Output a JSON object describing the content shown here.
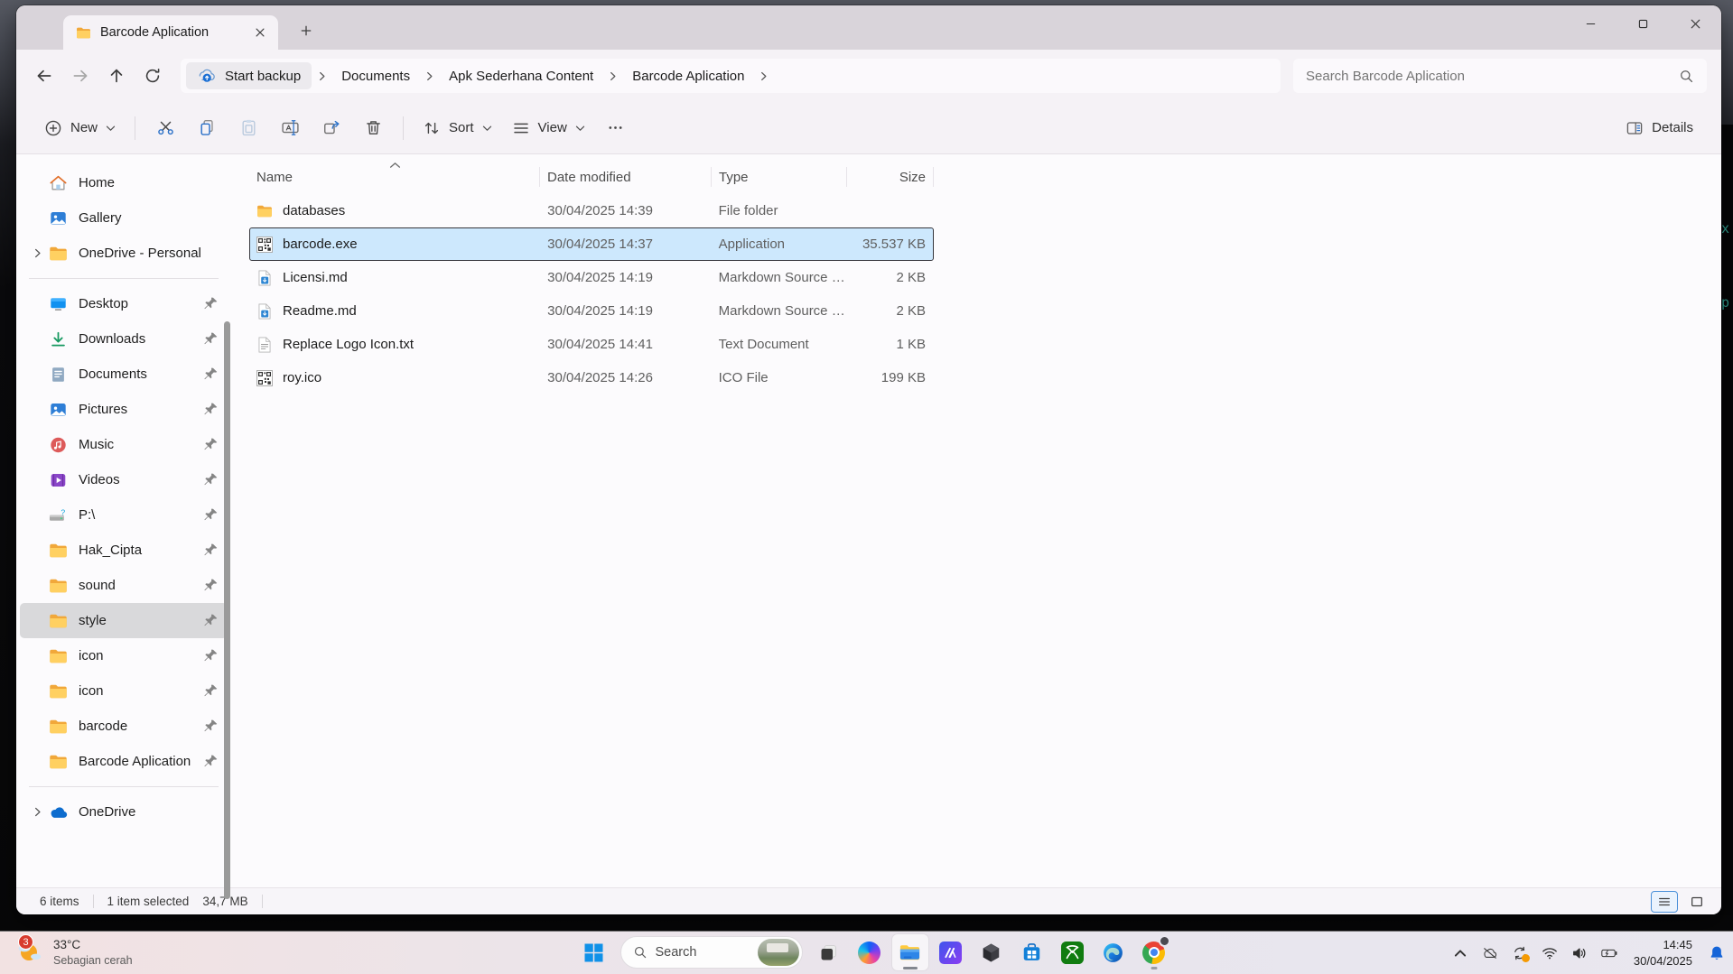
{
  "background": {
    "edge_marks": [
      "x",
      "p"
    ]
  },
  "window": {
    "tab": {
      "title": "Barcode Aplication"
    },
    "breadcrumb": {
      "backup_label": "Start backup",
      "items": [
        "Documents",
        "Apk Sederhana Content",
        "Barcode Aplication"
      ]
    },
    "search": {
      "placeholder": "Search Barcode Aplication"
    },
    "toolbar": {
      "new_label": "New",
      "sort_label": "Sort",
      "view_label": "View",
      "details_label": "Details"
    },
    "columns": {
      "name": "Name",
      "date_modified": "Date modified",
      "type": "Type",
      "size": "Size"
    },
    "files": [
      {
        "name": "databases",
        "date": "30/04/2025 14:39",
        "type": "File folder",
        "size": "",
        "icon": "folder-icon",
        "selected": false
      },
      {
        "name": "barcode.exe",
        "date": "30/04/2025 14:37",
        "type": "Application",
        "size": "35.537 KB",
        "icon": "barcode-app-icon",
        "selected": true
      },
      {
        "name": "Licensi.md",
        "date": "30/04/2025 14:19",
        "type": "Markdown Source …",
        "size": "2 KB",
        "icon": "markdown-file-icon",
        "selected": false
      },
      {
        "name": "Readme.md",
        "date": "30/04/2025 14:19",
        "type": "Markdown Source …",
        "size": "2 KB",
        "icon": "markdown-file-icon",
        "selected": false
      },
      {
        "name": "Replace Logo Icon.txt",
        "date": "30/04/2025 14:41",
        "type": "Text Document",
        "size": "1 KB",
        "icon": "text-file-icon",
        "selected": false
      },
      {
        "name": "roy.ico",
        "date": "30/04/2025 14:26",
        "type": "ICO File",
        "size": "199 KB",
        "icon": "ico-file-icon",
        "selected": false
      }
    ],
    "sidebar": {
      "sections": [
        {
          "items": [
            {
              "label": "Home",
              "icon": "home-icon",
              "pinned": false,
              "expander": false,
              "selected": false
            },
            {
              "label": "Gallery",
              "icon": "gallery-icon",
              "pinned": false,
              "expander": false,
              "selected": false
            },
            {
              "label": "OneDrive - Personal",
              "icon": "folder-icon",
              "pinned": false,
              "expander": true,
              "selected": false
            }
          ]
        },
        {
          "items": [
            {
              "label": "Desktop",
              "icon": "desktop-icon",
              "pinned": true,
              "expander": false,
              "selected": false
            },
            {
              "label": "Downloads",
              "icon": "downloads-icon",
              "pinned": true,
              "expander": false,
              "selected": false
            },
            {
              "label": "Documents",
              "icon": "documents-icon",
              "pinned": true,
              "expander": false,
              "selected": false
            },
            {
              "label": "Pictures",
              "icon": "pictures-icon",
              "pinned": true,
              "expander": false,
              "selected": false
            },
            {
              "label": "Music",
              "icon": "music-icon",
              "pinned": true,
              "expander": false,
              "selected": false
            },
            {
              "label": "Videos",
              "icon": "videos-icon",
              "pinned": true,
              "expander": false,
              "selected": false
            },
            {
              "label": "P:\\",
              "icon": "drive-icon",
              "pinned": true,
              "expander": false,
              "selected": false
            },
            {
              "label": "Hak_Cipta",
              "icon": "folder-icon",
              "pinned": true,
              "expander": false,
              "selected": false
            },
            {
              "label": "sound",
              "icon": "folder-icon",
              "pinned": true,
              "expander": false,
              "selected": false
            },
            {
              "label": "style",
              "icon": "folder-icon",
              "pinned": true,
              "expander": false,
              "selected": true
            },
            {
              "label": "icon",
              "icon": "folder-icon",
              "pinned": true,
              "expander": false,
              "selected": false
            },
            {
              "label": "icon",
              "icon": "folder-icon",
              "pinned": true,
              "expander": false,
              "selected": false
            },
            {
              "label": "barcode",
              "icon": "folder-icon",
              "pinned": true,
              "expander": false,
              "selected": false
            },
            {
              "label": "Barcode Aplication",
              "icon": "folder-icon",
              "pinned": true,
              "expander": false,
              "selected": false
            }
          ]
        },
        {
          "items": [
            {
              "label": "OneDrive",
              "icon": "onedrive-icon",
              "pinned": false,
              "expander": true,
              "selected": false
            }
          ]
        }
      ]
    },
    "statusbar": {
      "items_count": "6 items",
      "selected_count": "1 item selected",
      "selected_size": "34,7 MB"
    }
  },
  "taskbar": {
    "weather": {
      "badge": "3",
      "temp": "33°C",
      "condition": "Sebagian cerah"
    },
    "search_label": "Search",
    "clock": {
      "time": "14:45",
      "date": "30/04/2025"
    }
  },
  "icons": [
    "folder-icon",
    "home-icon",
    "gallery-icon",
    "pictures-icon",
    "onedrive-icon",
    "desktop-icon",
    "downloads-icon",
    "documents-icon",
    "music-icon",
    "videos-icon",
    "drive-icon",
    "pin-icon",
    "chevron-right-icon",
    "chevron-down-icon",
    "caret-up-icon",
    "back-icon",
    "forward-icon",
    "up-icon",
    "refresh-icon",
    "search-icon",
    "start-backup-cloud-icon",
    "plus-circle-icon",
    "plus-icon",
    "close-icon",
    "minimize-icon",
    "maximize-icon",
    "cut-icon",
    "copy-icon",
    "paste-icon",
    "rename-icon",
    "share-icon",
    "delete-icon",
    "sort-icon",
    "view-icon",
    "ellipsis-icon",
    "details-pane-icon",
    "barcode-app-icon",
    "markdown-file-icon",
    "text-file-icon",
    "ico-file-icon",
    "details-view-icon",
    "icons-view-icon",
    "weather-icon",
    "windows-start-icon",
    "task-view-icon",
    "copilot-icon",
    "file-explorer-icon",
    "slashes-app-icon",
    "hexagon-app-icon",
    "ms-store-icon",
    "xbox-icon",
    "edge-icon",
    "chrome-icon",
    "avatar",
    "tray-chevron-up-icon",
    "cloud-off-icon",
    "sync-icon",
    "wifi-icon",
    "volume-icon",
    "battery-icon",
    "bell-icon"
  ]
}
